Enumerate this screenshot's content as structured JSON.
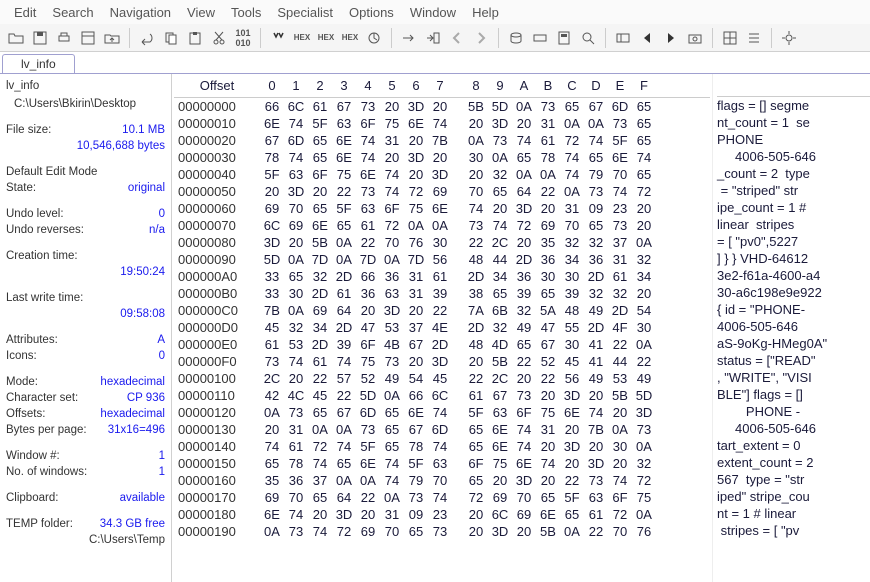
{
  "menu": [
    "Edit",
    "Search",
    "Navigation",
    "View",
    "Tools",
    "Specialist",
    "Options",
    "Window",
    "Help"
  ],
  "tab": "lv_info",
  "sidebar": {
    "title": "lv_info",
    "path": "C:\\Users\\Bkirin\\Desktop",
    "fileSizeLabel": "File size:",
    "fileSize1": "10.1 MB",
    "fileSize2": "10,546,688 bytes",
    "editModeHdr": "Default Edit Mode",
    "stateLabel": "State:",
    "stateVal": "original",
    "undoLevelLabel": "Undo level:",
    "undoLevelVal": "0",
    "undoRevLabel": "Undo reverses:",
    "undoRevVal": "n/a",
    "creationLabel": "Creation time:",
    "creationVal": "19:50:24",
    "lastWriteLabel": "Last write time:",
    "lastWriteVal": "09:58:08",
    "attrLabel": "Attributes:",
    "attrVal": "A",
    "iconsLabel": "Icons:",
    "iconsVal": "0",
    "modeLabel": "Mode:",
    "modeVal": "hexadecimal",
    "charsetLabel": "Character set:",
    "charsetVal": "CP 936",
    "offsetsLabel": "Offsets:",
    "offsetsVal": "hexadecimal",
    "bppLabel": "Bytes per page:",
    "bppVal": "31x16=496",
    "winNumLabel": "Window #:",
    "winNumVal": "1",
    "noWinLabel": "No. of windows:",
    "noWinVal": "1",
    "clipLabel": "Clipboard:",
    "clipVal": "available",
    "tempLabel": "TEMP folder:",
    "tempVal": "34.3 GB free",
    "tempPath": "C:\\Users\\Temp"
  },
  "hex": {
    "offsetHdr": "Offset",
    "cols": [
      "0",
      "1",
      "2",
      "3",
      "4",
      "5",
      "6",
      "7",
      "8",
      "9",
      "A",
      "B",
      "C",
      "D",
      "E",
      "F"
    ],
    "rows": [
      {
        "o": "00000000",
        "b": [
          "66",
          "6C",
          "61",
          "67",
          "73",
          "20",
          "3D",
          "20",
          "5B",
          "5D",
          "0A",
          "73",
          "65",
          "67",
          "6D",
          "65"
        ]
      },
      {
        "o": "00000010",
        "b": [
          "6E",
          "74",
          "5F",
          "63",
          "6F",
          "75",
          "6E",
          "74",
          "20",
          "3D",
          "20",
          "31",
          "0A",
          "0A",
          "73",
          "65"
        ]
      },
      {
        "o": "00000020",
        "b": [
          "67",
          "6D",
          "65",
          "6E",
          "74",
          "31",
          "20",
          "7B",
          "0A",
          "73",
          "74",
          "61",
          "72",
          "74",
          "5F",
          "65"
        ]
      },
      {
        "o": "00000030",
        "b": [
          "78",
          "74",
          "65",
          "6E",
          "74",
          "20",
          "3D",
          "20",
          "30",
          "0A",
          "65",
          "78",
          "74",
          "65",
          "6E",
          "74"
        ]
      },
      {
        "o": "00000040",
        "b": [
          "5F",
          "63",
          "6F",
          "75",
          "6E",
          "74",
          "20",
          "3D",
          "20",
          "32",
          "0A",
          "0A",
          "74",
          "79",
          "70",
          "65"
        ]
      },
      {
        "o": "00000050",
        "b": [
          "20",
          "3D",
          "20",
          "22",
          "73",
          "74",
          "72",
          "69",
          "70",
          "65",
          "64",
          "22",
          "0A",
          "73",
          "74",
          "72"
        ]
      },
      {
        "o": "00000060",
        "b": [
          "69",
          "70",
          "65",
          "5F",
          "63",
          "6F",
          "75",
          "6E",
          "74",
          "20",
          "3D",
          "20",
          "31",
          "09",
          "23",
          "20"
        ]
      },
      {
        "o": "00000070",
        "b": [
          "6C",
          "69",
          "6E",
          "65",
          "61",
          "72",
          "0A",
          "0A",
          "73",
          "74",
          "72",
          "69",
          "70",
          "65",
          "73",
          "20"
        ]
      },
      {
        "o": "00000080",
        "b": [
          "3D",
          "20",
          "5B",
          "0A",
          "22",
          "70",
          "76",
          "30",
          "22",
          "2C",
          "20",
          "35",
          "32",
          "32",
          "37",
          "0A"
        ]
      },
      {
        "o": "00000090",
        "b": [
          "5D",
          "0A",
          "7D",
          "0A",
          "7D",
          "0A",
          "7D",
          "56",
          "48",
          "44",
          "2D",
          "36",
          "34",
          "36",
          "31",
          "32"
        ]
      },
      {
        "o": "000000A0",
        "b": [
          "33",
          "65",
          "32",
          "2D",
          "66",
          "36",
          "31",
          "61",
          "2D",
          "34",
          "36",
          "30",
          "30",
          "2D",
          "61",
          "34"
        ]
      },
      {
        "o": "000000B0",
        "b": [
          "33",
          "30",
          "2D",
          "61",
          "36",
          "63",
          "31",
          "39",
          "38",
          "65",
          "39",
          "65",
          "39",
          "32",
          "32",
          "20"
        ]
      },
      {
        "o": "000000C0",
        "b": [
          "7B",
          "0A",
          "69",
          "64",
          "20",
          "3D",
          "20",
          "22",
          "7A",
          "6B",
          "32",
          "5A",
          "48",
          "49",
          "2D",
          "54"
        ]
      },
      {
        "o": "000000D0",
        "b": [
          "45",
          "32",
          "34",
          "2D",
          "47",
          "53",
          "37",
          "4E",
          "2D",
          "32",
          "49",
          "47",
          "55",
          "2D",
          "4F",
          "30"
        ]
      },
      {
        "o": "000000E0",
        "b": [
          "61",
          "53",
          "2D",
          "39",
          "6F",
          "4B",
          "67",
          "2D",
          "48",
          "4D",
          "65",
          "67",
          "30",
          "41",
          "22",
          "0A"
        ]
      },
      {
        "o": "000000F0",
        "b": [
          "73",
          "74",
          "61",
          "74",
          "75",
          "73",
          "20",
          "3D",
          "20",
          "5B",
          "22",
          "52",
          "45",
          "41",
          "44",
          "22"
        ]
      },
      {
        "o": "00000100",
        "b": [
          "2C",
          "20",
          "22",
          "57",
          "52",
          "49",
          "54",
          "45",
          "22",
          "2C",
          "20",
          "22",
          "56",
          "49",
          "53",
          "49"
        ]
      },
      {
        "o": "00000110",
        "b": [
          "42",
          "4C",
          "45",
          "22",
          "5D",
          "0A",
          "66",
          "6C",
          "61",
          "67",
          "73",
          "20",
          "3D",
          "20",
          "5B",
          "5D"
        ]
      },
      {
        "o": "00000120",
        "b": [
          "0A",
          "73",
          "65",
          "67",
          "6D",
          "65",
          "6E",
          "74",
          "5F",
          "63",
          "6F",
          "75",
          "6E",
          "74",
          "20",
          "3D"
        ]
      },
      {
        "o": "00000130",
        "b": [
          "20",
          "31",
          "0A",
          "0A",
          "73",
          "65",
          "67",
          "6D",
          "65",
          "6E",
          "74",
          "31",
          "20",
          "7B",
          "0A",
          "73"
        ]
      },
      {
        "o": "00000140",
        "b": [
          "74",
          "61",
          "72",
          "74",
          "5F",
          "65",
          "78",
          "74",
          "65",
          "6E",
          "74",
          "20",
          "3D",
          "20",
          "30",
          "0A"
        ]
      },
      {
        "o": "00000150",
        "b": [
          "65",
          "78",
          "74",
          "65",
          "6E",
          "74",
          "5F",
          "63",
          "6F",
          "75",
          "6E",
          "74",
          "20",
          "3D",
          "20",
          "32"
        ]
      },
      {
        "o": "00000160",
        "b": [
          "35",
          "36",
          "37",
          "0A",
          "0A",
          "74",
          "79",
          "70",
          "65",
          "20",
          "3D",
          "20",
          "22",
          "73",
          "74",
          "72"
        ]
      },
      {
        "o": "00000170",
        "b": [
          "69",
          "70",
          "65",
          "64",
          "22",
          "0A",
          "73",
          "74",
          "72",
          "69",
          "70",
          "65",
          "5F",
          "63",
          "6F",
          "75"
        ]
      },
      {
        "o": "00000180",
        "b": [
          "6E",
          "74",
          "20",
          "3D",
          "20",
          "31",
          "09",
          "23",
          "20",
          "6C",
          "69",
          "6E",
          "65",
          "61",
          "72",
          "0A"
        ]
      },
      {
        "o": "00000190",
        "b": [
          "0A",
          "73",
          "74",
          "72",
          "69",
          "70",
          "65",
          "73",
          "20",
          "3D",
          "20",
          "5B",
          "0A",
          "22",
          "70",
          "76"
        ]
      }
    ],
    "ascii": [
      "flags = [] segme",
      "nt_count = 1  se",
      "PHONE",
      "     4006-505-646",
      "_count = 2  type",
      " = \"striped\" str",
      "ipe_count = 1 # ",
      "linear  stripes ",
      "= [ \"pv0\",5227 ",
      "] } } VHD-64612",
      "3e2-f61a-4600-a4",
      "30-a6c198e9e922 ",
      "{ id = \"PHONE-",
      "4006-505-646",
      "aS-9oKg-HMeg0A\" ",
      "status = [\"READ\"",
      ", \"WRITE\", \"VISI",
      "BLE\"] flags = []",
      "        PHONE -",
      "     4006-505-646",
      "tart_extent = 0 ",
      "extent_count = 2",
      "567  type = \"str",
      "iped\" stripe_cou",
      "nt = 1 # linear ",
      " stripes = [ \"pv"
    ]
  }
}
